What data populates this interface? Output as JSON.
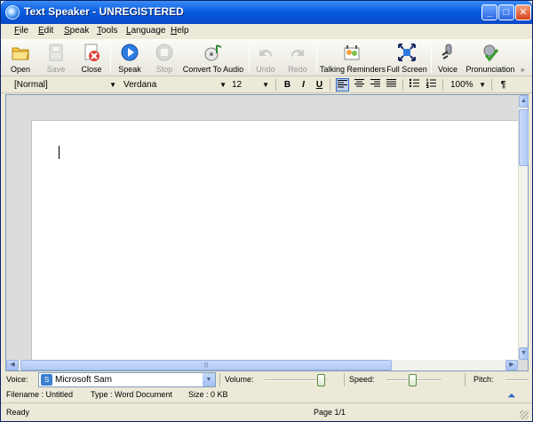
{
  "window": {
    "title": "Text Speaker - UNREGISTERED"
  },
  "menu": [
    {
      "label": "File",
      "key": "F",
      "rest": "ile"
    },
    {
      "label": "Edit",
      "key": "E",
      "rest": "dit"
    },
    {
      "label": "Speak",
      "key": "S",
      "rest": "peak"
    },
    {
      "label": "Tools",
      "key": "T",
      "rest": "ools"
    },
    {
      "label": "Language",
      "key": "L",
      "rest": "anguage"
    },
    {
      "label": "Help",
      "key": "H",
      "rest": "elp"
    }
  ],
  "toolbar": {
    "open": "Open",
    "save": "Save",
    "close": "Close",
    "speak": "Speak",
    "stop": "Stop",
    "convert": "Convert To Audio",
    "undo": "Undo",
    "redo": "Redo",
    "talking_reminders": "Talking Reminders",
    "full_screen": "Full Screen",
    "voice": "Voice",
    "pronunciation": "Pronunciation",
    "overflow": "»"
  },
  "format": {
    "style": "[Normal]",
    "font": "Verdana",
    "size": "12",
    "bold": "B",
    "italic": "I",
    "underline": "U",
    "zoom": "100%",
    "paragraph": "¶"
  },
  "voicebar": {
    "voice_label": "Voice:",
    "voice_value": "Microsoft Sam",
    "volume_label": "Volume:",
    "speed_label": "Speed:",
    "pitch_label": "Pitch:",
    "volume_level": 0.92,
    "speed_level": 0.48
  },
  "info": {
    "filename": "Filename : Untitled",
    "type": "Type : Word Document",
    "size": "Size : 0 KB"
  },
  "status": {
    "state": "Ready",
    "page": "Page 1/1"
  },
  "colors": {
    "titlebar": "#0a5ee0",
    "chrome": "#ece9d8",
    "active_button": "#c1d2ee"
  }
}
